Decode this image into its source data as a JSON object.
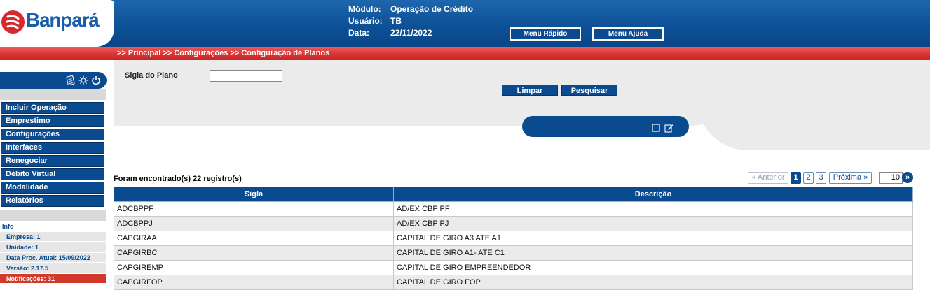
{
  "header": {
    "logo_text": "Banpará",
    "modulo_label": "Módulo:",
    "modulo_value": "Operação de Crédito",
    "usuario_label": "Usuário:",
    "usuario_value": "TB",
    "data_label": "Data:",
    "data_value": "22/11/2022",
    "menu_rapido": "Menu Rápido",
    "menu_ajuda": "Menu Ajuda"
  },
  "breadcrumb": ">> Principal >> Configurações  >> Configuração de Planos",
  "search": {
    "label": "Sigla do Plano",
    "value": "",
    "limpar": "Limpar",
    "pesquisar": "Pesquisar"
  },
  "sidebar": {
    "items": [
      "Incluir Operação",
      "Emprestimo",
      "Configurações",
      "Interfaces",
      "Renegociar",
      "Débito Virtual",
      "Modalidade",
      "Relatórios"
    ],
    "info_title": "Info",
    "info": [
      "Empresa: 1",
      "Unidade: 1",
      "Data Proc. Atual: 15/09/2022",
      "Versão: 2.17.5",
      "Notificações: 31"
    ]
  },
  "results": {
    "found": "Foram encontrado(s) 22 registro(s)",
    "pager": {
      "prev": "« Anterior",
      "pages": [
        "1",
        "2",
        "3"
      ],
      "next": "Próxima »",
      "page_size": "10",
      "go": "»"
    },
    "columns": [
      "Sigla",
      "Descrição"
    ],
    "rows": [
      [
        "ADCBPPF",
        "AD/EX CBP PF"
      ],
      [
        "ADCBPPJ",
        "AD/EX CBP PJ"
      ],
      [
        "CAPGIRAA",
        "CAPITAL DE GIRO A3 ATE A1"
      ],
      [
        "CAPGIRBC",
        "CAPITAL DE GIRO A1- ATE C1"
      ],
      [
        "CAPGIREMP",
        "CAPITAL DE GIRO EMPREENDEDOR"
      ],
      [
        "CAPGIRFOP",
        "CAPITAL DE GIRO FOP"
      ]
    ]
  },
  "colors": {
    "primary_blue": "#0a4a8f",
    "brand_red": "#d83535",
    "grey_panel": "#ebebeb"
  }
}
